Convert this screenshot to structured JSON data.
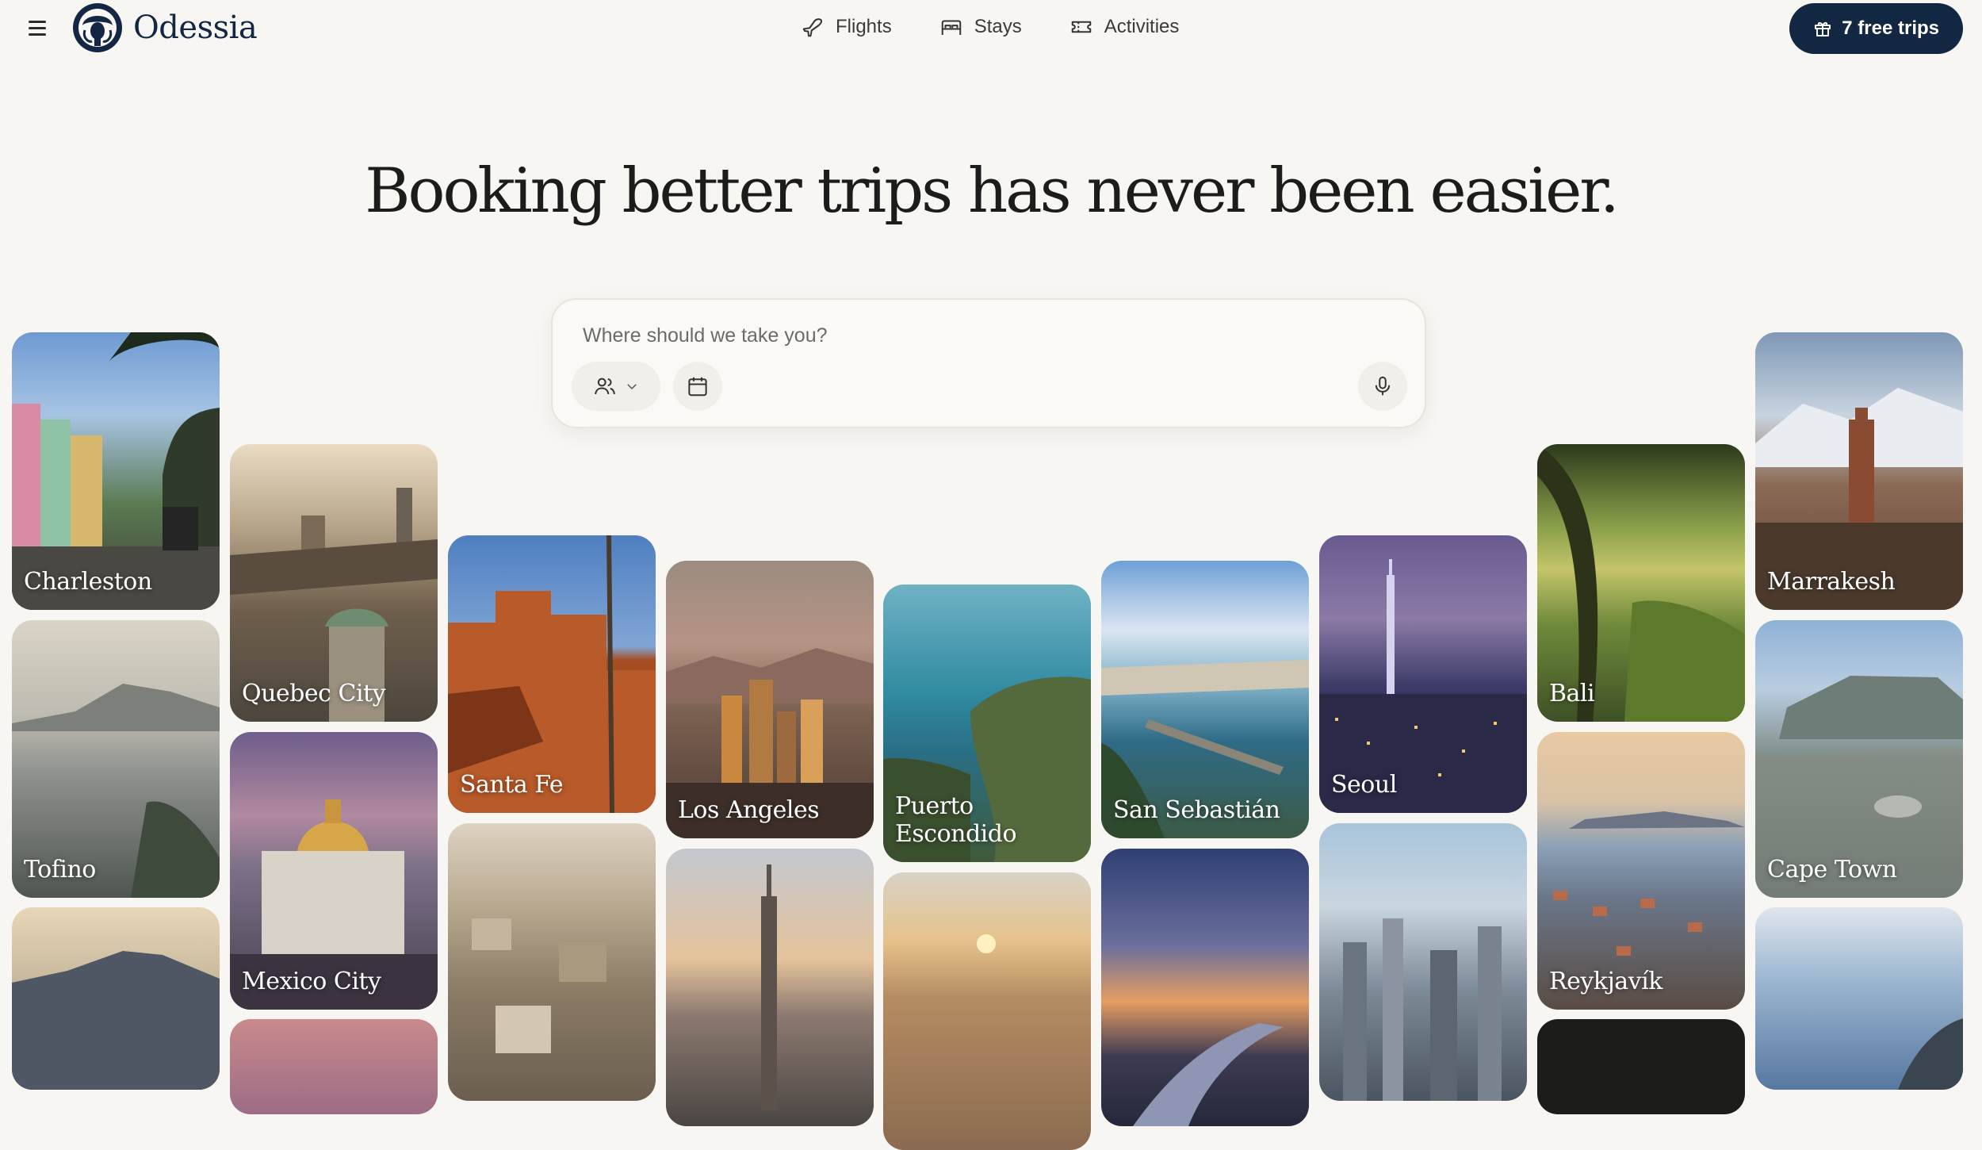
{
  "brand": {
    "name": "Odessia"
  },
  "nav": {
    "items": [
      {
        "label": "Flights",
        "icon": "plane-icon"
      },
      {
        "label": "Stays",
        "icon": "bed-icon"
      },
      {
        "label": "Activities",
        "icon": "ticket-icon"
      }
    ],
    "cta_label": "7 free trips",
    "cta_icon": "gift-icon"
  },
  "hero": {
    "headline": "Booking better trips has never been easier."
  },
  "search": {
    "placeholder": "Where should we take you?",
    "value": "",
    "guests_icon": "users-icon",
    "calendar_icon": "calendar-icon",
    "mic_icon": "microphone-icon"
  },
  "destinations": [
    {
      "name": "Charleston"
    },
    {
      "name": "Tofino"
    },
    {
      "name": ""
    },
    {
      "name": "Quebec City"
    },
    {
      "name": "Mexico City"
    },
    {
      "name": ""
    },
    {
      "name": "Santa Fe"
    },
    {
      "name": ""
    },
    {
      "name": "Los Angeles"
    },
    {
      "name": ""
    },
    {
      "name": "Puerto Escondido"
    },
    {
      "name": ""
    },
    {
      "name": "San Sebastián"
    },
    {
      "name": ""
    },
    {
      "name": "Seoul"
    },
    {
      "name": ""
    },
    {
      "name": "Bali"
    },
    {
      "name": "Reykjavík"
    },
    {
      "name": ""
    },
    {
      "name": "Marrakesh"
    },
    {
      "name": "Cape Town"
    },
    {
      "name": ""
    }
  ],
  "colors": {
    "brand_navy": "#122742",
    "background": "#f7f6f2"
  }
}
